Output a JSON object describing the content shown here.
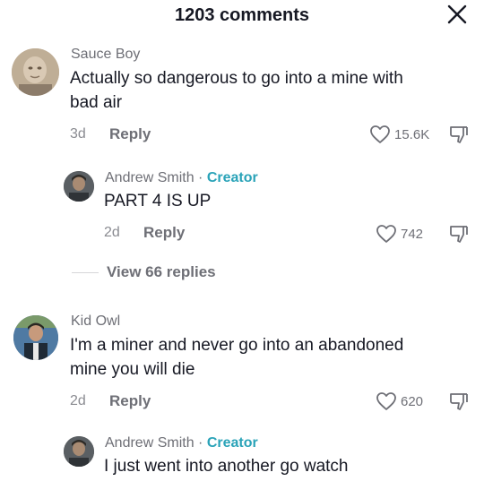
{
  "header": {
    "title": "1203 comments",
    "close_icon": "close-icon"
  },
  "comments": [
    {
      "username": "Sauce Boy",
      "text_lines": [
        "Actually so dangerous to go into a mine with",
        "bad air"
      ],
      "time": "3d",
      "reply_label": "Reply",
      "likes": "15.6K",
      "replies": [
        {
          "username": "Andrew Smith",
          "separator": "·",
          "badge": "Creator",
          "text_lines": [
            "PART 4 IS UP"
          ],
          "time": "2d",
          "reply_label": "Reply",
          "likes": "742"
        }
      ],
      "view_replies": "View 66 replies"
    },
    {
      "username": "Kid Owl",
      "text_lines": [
        "I'm a miner and never go into an abandoned",
        "mine you will die"
      ],
      "time": "2d",
      "reply_label": "Reply",
      "likes": "620",
      "replies": [
        {
          "username": "Andrew Smith",
          "separator": "·",
          "badge": "Creator",
          "text_lines": [
            "I just went into another go watch"
          ]
        }
      ]
    }
  ],
  "colors": {
    "creator_badge": "#2aa3b8",
    "secondary_text": "#6e6f76",
    "primary_text": "#161823"
  }
}
